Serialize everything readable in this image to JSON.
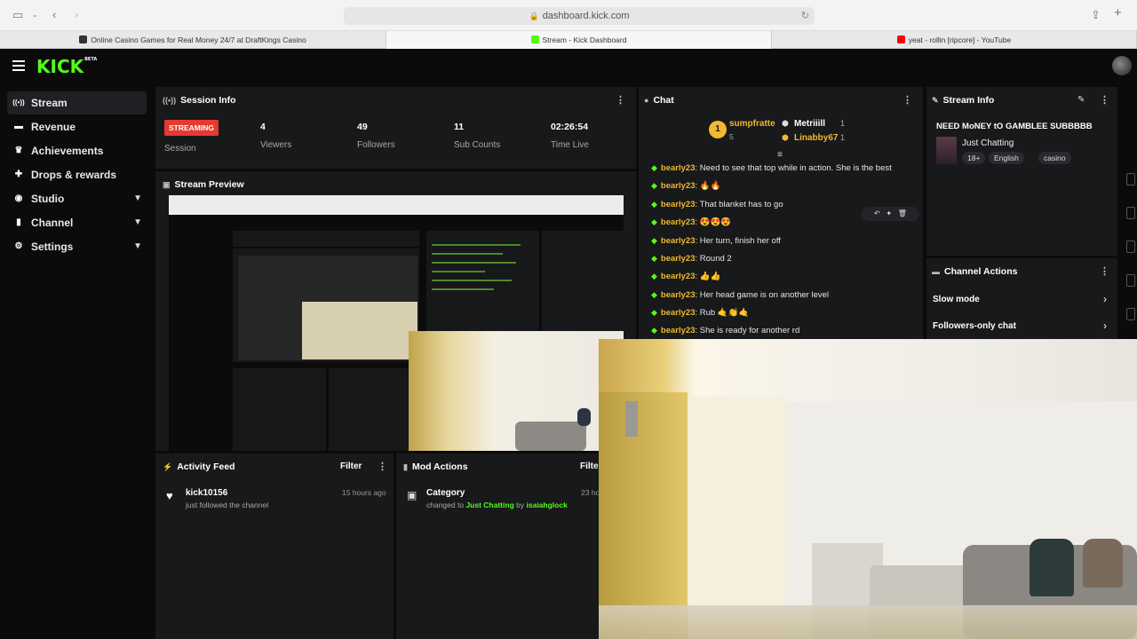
{
  "browser": {
    "url": "dashboard.kick.com",
    "tabs": [
      {
        "label": "Online Casino Games for Real Money 24/7 at DraftKings Casino",
        "favicon_color": "#333333"
      },
      {
        "label": "Stream - Kick Dashboard",
        "favicon_color": "#53fc18"
      },
      {
        "label": "yeat - rollin [ripcore] - YouTube",
        "favicon_color": "#ff0000"
      }
    ]
  },
  "brand": {
    "logo": "KICK",
    "beta": "BETA",
    "accent": "#53fc18"
  },
  "sidebar": {
    "items": [
      {
        "label": "Stream",
        "icon": "broadcast-icon",
        "glyph": "((•))"
      },
      {
        "label": "Revenue",
        "icon": "wallet-icon",
        "glyph": "▬"
      },
      {
        "label": "Achievements",
        "icon": "trophy-icon",
        "glyph": "🏆"
      },
      {
        "label": "Drops & rewards",
        "icon": "gift-icon",
        "glyph": "🎁"
      },
      {
        "label": "Studio",
        "icon": "studio-icon",
        "glyph": "◉"
      },
      {
        "label": "Channel",
        "icon": "channel-icon",
        "glyph": "▮▮"
      },
      {
        "label": "Settings",
        "icon": "gear-icon",
        "glyph": "⚙"
      }
    ]
  },
  "session_info": {
    "title": "Session Info",
    "status": "STREAMING",
    "status_label": "Session",
    "stats": [
      {
        "value": "4",
        "label": "Viewers"
      },
      {
        "value": "49",
        "label": "Followers"
      },
      {
        "value": "11",
        "label": "Sub Counts"
      },
      {
        "value": "02:26:54",
        "label": "Time Live"
      }
    ]
  },
  "stream_preview": {
    "title": "Stream Preview"
  },
  "activity_feed": {
    "title": "Activity Feed",
    "filter": "Filter",
    "items": [
      {
        "name": "kick10156",
        "desc": "just followed the channel",
        "time": "15 hours ago"
      }
    ]
  },
  "mod_actions": {
    "title": "Mod Actions",
    "filter": "Filte",
    "items": [
      {
        "title": "Category",
        "prefix": "changed to",
        "category": "Just Chatting",
        "by": "by",
        "moderator": "isaiahglock",
        "time": "23 ho"
      }
    ]
  },
  "chat": {
    "title": "Chat",
    "top_gifters": [
      {
        "rank": "1",
        "name": "sumpfratte",
        "count": "5"
      },
      {
        "name": "Metriiill",
        "count": "1"
      },
      {
        "name": "Linabby67",
        "count": "1"
      }
    ],
    "messages": [
      {
        "user": "bearly23",
        "text": "Need to see that top while in action. She is the best"
      },
      {
        "user": "bearly23",
        "text": "🔥🔥"
      },
      {
        "user": "bearly23",
        "text": "That blanket has to go"
      },
      {
        "user": "bearly23",
        "text": "😍😍😍"
      },
      {
        "user": "bearly23",
        "text": "Her turn, finish her off"
      },
      {
        "user": "bearly23",
        "text": "Round 2"
      },
      {
        "user": "bearly23",
        "text": "👍👍"
      },
      {
        "user": "bearly23",
        "text": "Her head game is on another level"
      },
      {
        "user": "bearly23",
        "text": "Rub 🤙👏🤙"
      },
      {
        "user": "bearly23",
        "text": "She is ready for another rd"
      }
    ]
  },
  "stream_info": {
    "title": "Stream Info",
    "stream_title": "NEED MoNEY tO GAMBLEE SUBBBBB",
    "category": "Just Chatting",
    "tags": [
      "18+",
      "English",
      "casino"
    ]
  },
  "channel_actions": {
    "title": "Channel Actions",
    "items": [
      "Slow mode",
      "Followers-only chat"
    ]
  }
}
